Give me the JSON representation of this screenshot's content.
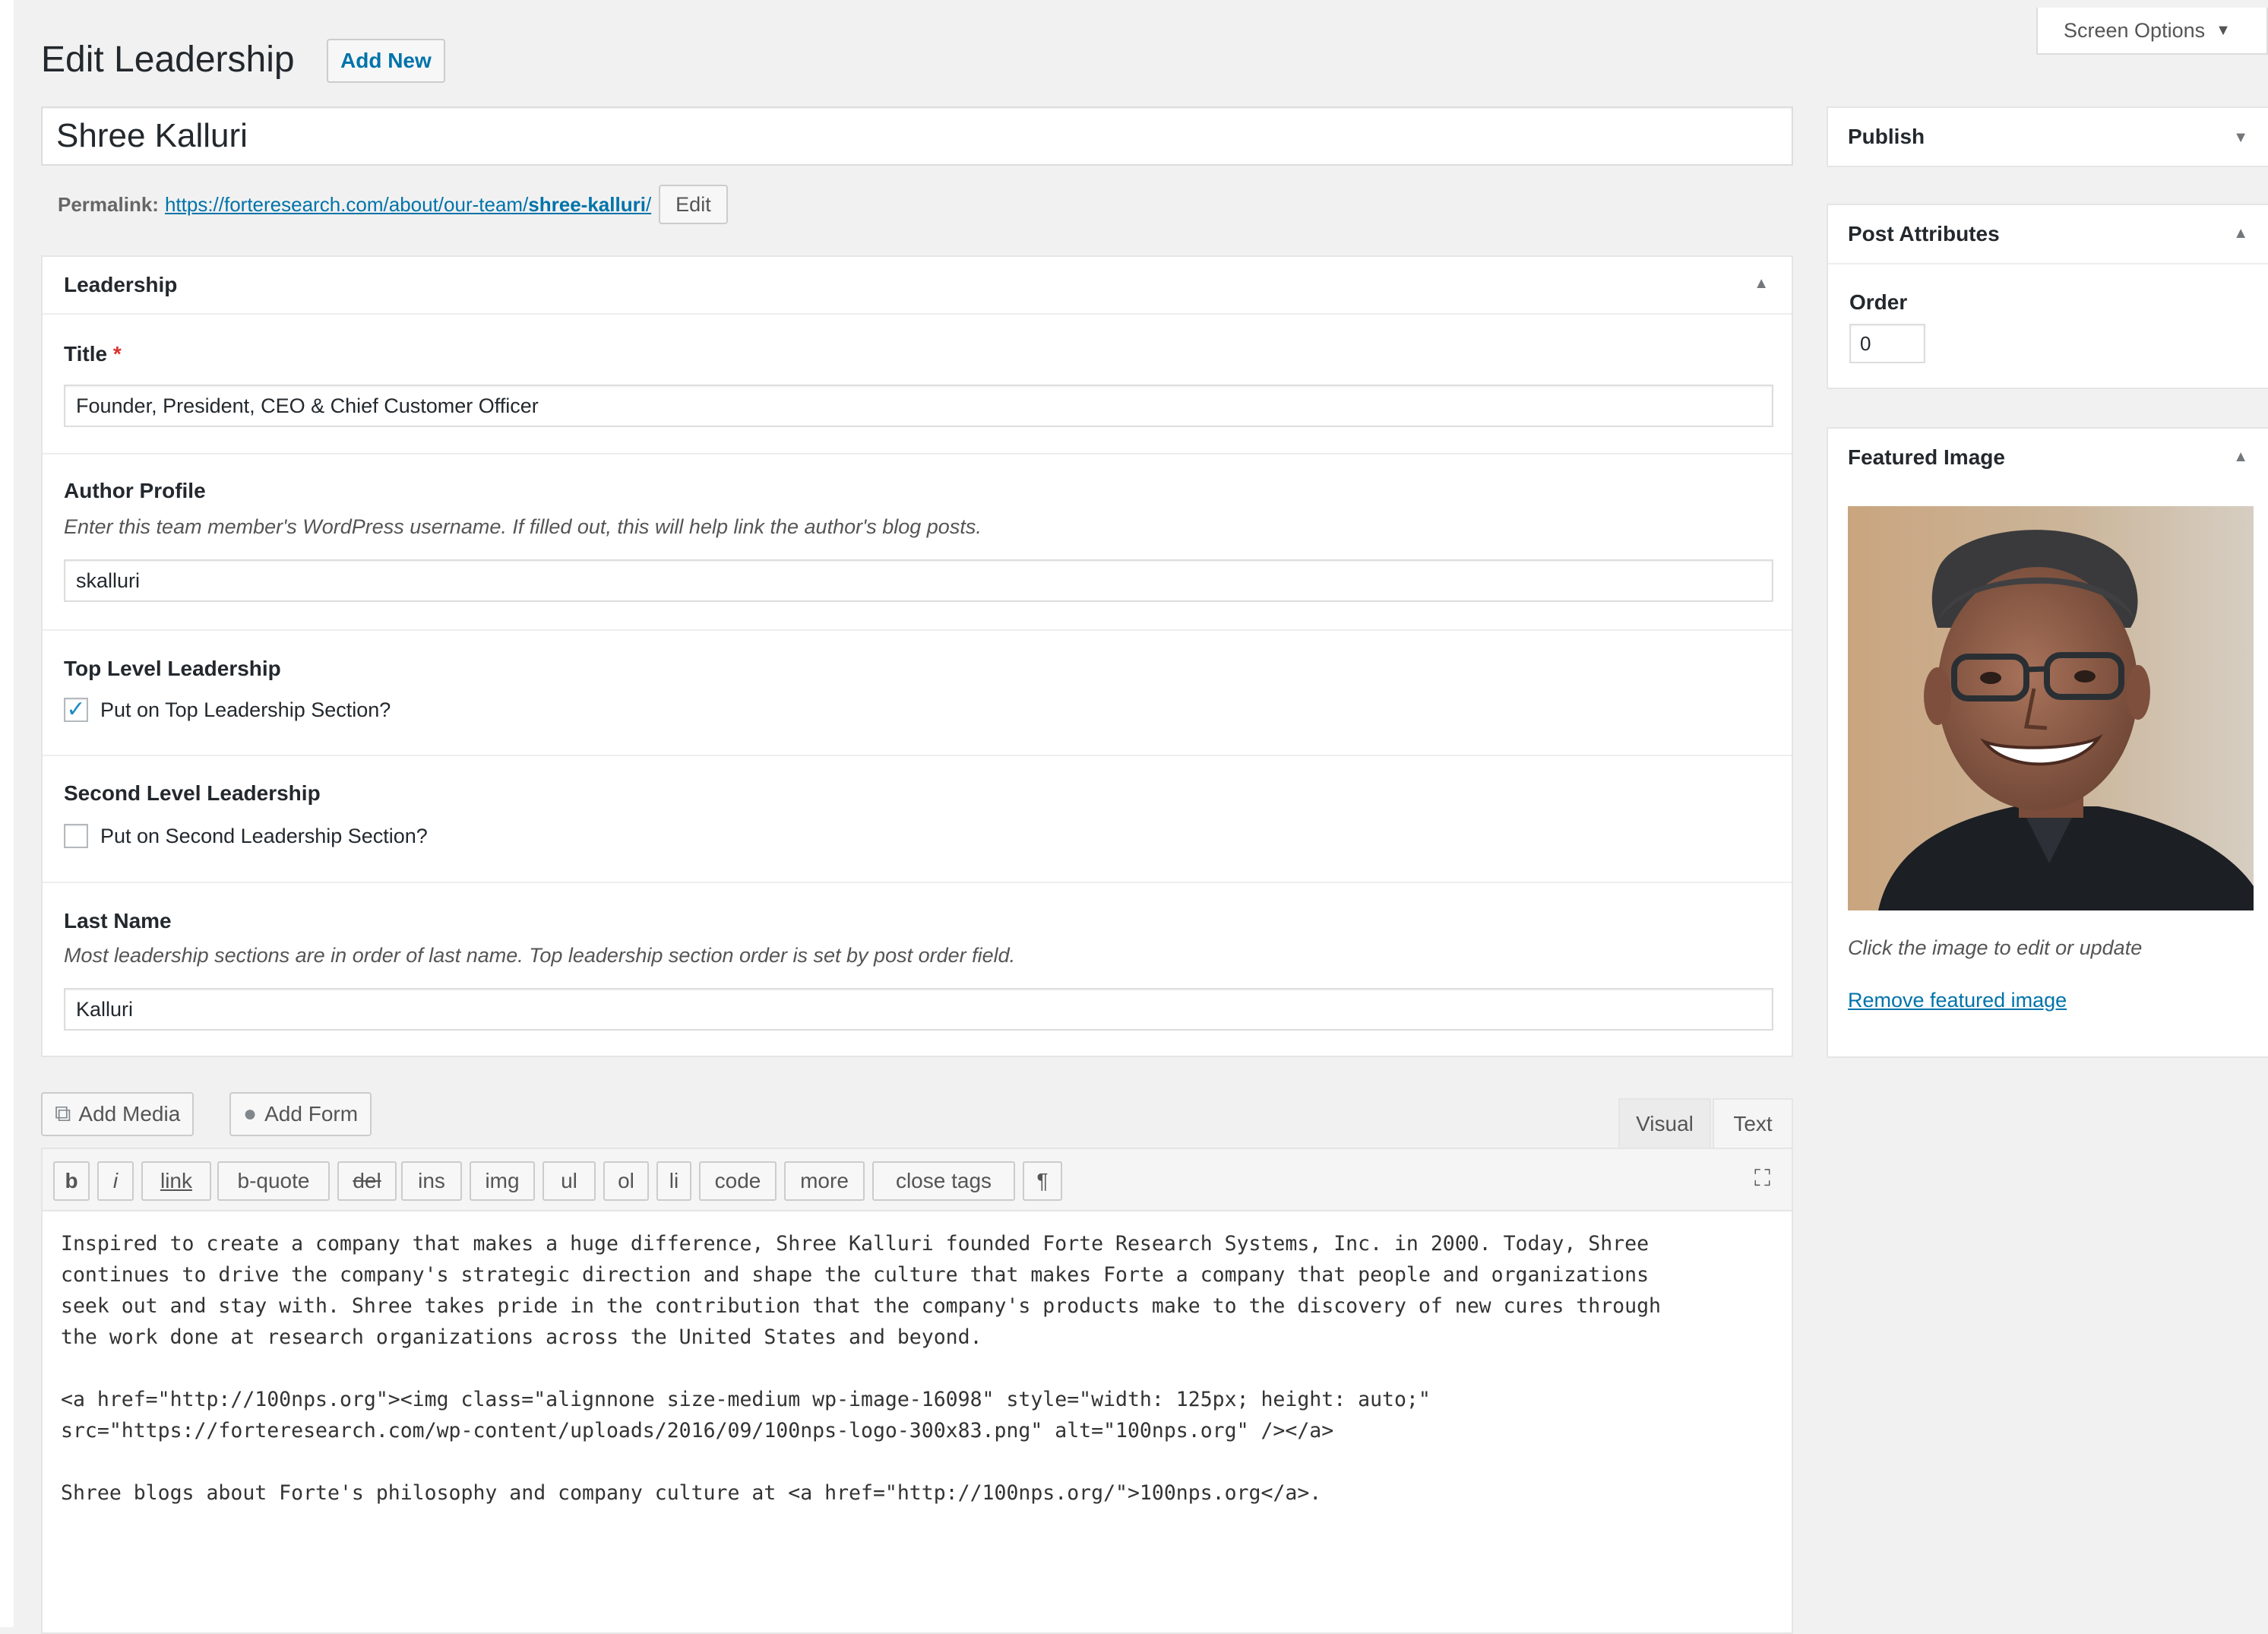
{
  "header": {
    "title": "Edit Leadership",
    "add_new": "Add New",
    "screen_options": "Screen Options"
  },
  "post": {
    "title": "Shree Kalluri",
    "permalink_label": "Permalink:",
    "permalink_base": "https://forteresearch.com/about/our-team/",
    "permalink_slug": "shree-kalluri",
    "permalink_trail": "/",
    "permalink_edit": "Edit"
  },
  "leadership_box": {
    "heading": "Leadership",
    "title_label": "Title",
    "required_mark": "*",
    "title_value": "Founder, President, CEO & Chief Customer Officer",
    "author_label": "Author Profile",
    "author_desc": "Enter this team member's WordPress username. If filled out, this will help link the author's blog posts.",
    "author_value": "skalluri",
    "top_label": "Top Level Leadership",
    "top_checkbox_label": "Put on Top Leadership Section?",
    "top_checked": true,
    "second_label": "Second Level Leadership",
    "second_checkbox_label": "Put on Second Leadership Section?",
    "second_checked": false,
    "lastname_label": "Last Name",
    "lastname_desc": "Most leadership sections are in order of last name. Top leadership section order is set by post order field.",
    "lastname_value": "Kalluri"
  },
  "media_buttons": {
    "add_media": "Add Media",
    "add_form": "Add Form"
  },
  "editor_tabs": {
    "visual": "Visual",
    "text": "Text"
  },
  "quicktags": [
    "b",
    "i",
    "link",
    "b-quote",
    "del",
    "ins",
    "img",
    "ul",
    "ol",
    "li",
    "code",
    "more",
    "close tags",
    "¶"
  ],
  "editor_content": [
    "Inspired to create a company that makes a huge difference, Shree Kalluri founded Forte Research Systems, Inc. in 2000. Today, Shree",
    "continues to drive the company's strategic direction and shape the culture that makes Forte a company that people and organizations",
    "seek out and stay with. Shree takes pride in the contribution that the company's products make to the discovery of new cures through",
    "the work done at research organizations across the United States and beyond.",
    "",
    "<a href=\"http://100nps.org\"><img class=\"alignnone size-medium wp-image-16098\" style=\"width: 125px; height: auto;\"",
    "src=\"https://forteresearch.com/wp-content/uploads/2016/09/100nps-logo-300x83.png\" alt=\"100nps.org\" /></a>",
    "",
    "Shree blogs about Forte's philosophy and company culture at <a href=\"http://100nps.org/\">100nps.org</a>."
  ],
  "sidebar": {
    "publish": "Publish",
    "post_attributes": "Post Attributes",
    "order_label": "Order",
    "order_value": "0",
    "featured_image": "Featured Image",
    "featured_caption": "Click the image to edit or update",
    "remove_featured": "Remove featured image"
  },
  "colors": {
    "link": "#0073aa",
    "required": "#dc3232",
    "check": "#1e8cbe",
    "background": "#f1f1f1"
  }
}
